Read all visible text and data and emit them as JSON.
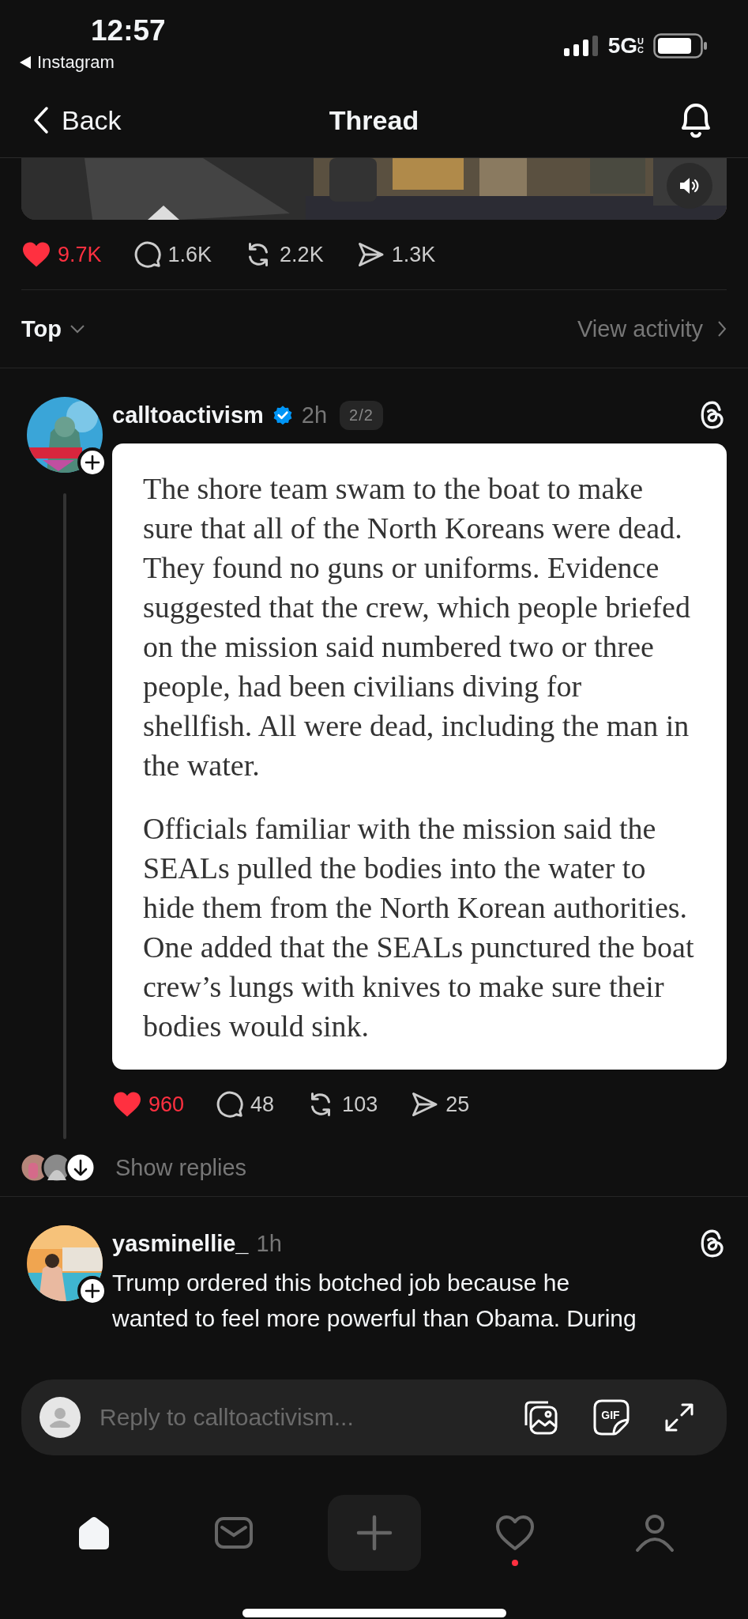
{
  "status_bar": {
    "time": "12:57",
    "back_app": "Instagram",
    "network": "5G",
    "network_suffix": "UC"
  },
  "header": {
    "back": "Back",
    "title": "Thread"
  },
  "media_stats": {
    "liked": true,
    "likes": "9.7K",
    "replies": "1.6K",
    "reposts": "2.2K",
    "shares": "1.3K"
  },
  "sort": {
    "label": "Top",
    "link": "View activity"
  },
  "posts": [
    {
      "username": "calltoactivism",
      "verified": true,
      "time": "2h",
      "part": "2/2",
      "card_paragraphs": [
        "The shore team swam to the boat to make sure that all of the North Koreans were dead. They found no guns or uniforms. Evidence suggested that the crew, which people briefed on the mission said numbered two or three people, had been civilians diving for shellfish. All were dead, including the man in the water.",
        "Officials familiar with the mission said the SEALs pulled the bodies into the water to hide them from the North Korean authorities. One added that the SEALs punctured the boat crew’s lungs with knives to make sure their bodies would sink."
      ],
      "stats": {
        "liked": true,
        "likes": "960",
        "replies": "48",
        "reposts": "103",
        "shares": "25"
      },
      "replies_link": "Show replies"
    },
    {
      "username": "yasminellie_",
      "verified": false,
      "time": "1h",
      "text_lines": [
        "Trump ordered this botched job because he",
        "wanted to feel more powerful than Obama. During"
      ]
    }
  ],
  "composer": {
    "placeholder": "Reply to calltoactivism...",
    "gif_label": "GIF"
  },
  "tab_bar": [
    {
      "kind": "home",
      "selected": true,
      "unread": false
    },
    {
      "kind": "inbox",
      "selected": false,
      "unread": false
    },
    {
      "kind": "compose",
      "selected": false,
      "unread": false
    },
    {
      "kind": "activity",
      "selected": false,
      "unread": true
    },
    {
      "kind": "profile",
      "selected": false,
      "unread": false
    }
  ]
}
